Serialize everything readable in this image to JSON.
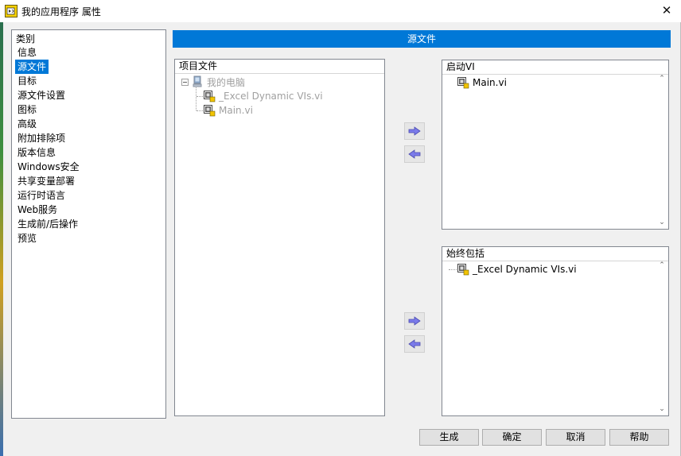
{
  "window": {
    "title": "我的应用程序 属性",
    "close_glyph": "✕"
  },
  "sidebar": {
    "header": "类别",
    "items": [
      {
        "label": "信息",
        "selected": false
      },
      {
        "label": "源文件",
        "selected": true
      },
      {
        "label": "目标",
        "selected": false
      },
      {
        "label": "源文件设置",
        "selected": false
      },
      {
        "label": "图标",
        "selected": false
      },
      {
        "label": "高级",
        "selected": false
      },
      {
        "label": "附加排除项",
        "selected": false
      },
      {
        "label": "版本信息",
        "selected": false
      },
      {
        "label": "Windows安全",
        "selected": false
      },
      {
        "label": "共享变量部署",
        "selected": false
      },
      {
        "label": "运行时语言",
        "selected": false
      },
      {
        "label": "Web服务",
        "selected": false
      },
      {
        "label": "生成前/后操作",
        "selected": false
      },
      {
        "label": "预览",
        "selected": false
      }
    ]
  },
  "main": {
    "section_title": "源文件",
    "project_files": {
      "header": "项目文件",
      "root": "我的电脑",
      "children": [
        "_Excel Dynamic VIs.vi",
        "Main.vi"
      ]
    },
    "startup_vis": {
      "header": "启动VI",
      "items": [
        "Main.vi"
      ]
    },
    "always_included": {
      "header": "始终包括",
      "items": [
        "_Excel Dynamic VIs.vi"
      ]
    },
    "arrow_glyphs": {
      "add": "⇨",
      "remove": "⇦"
    }
  },
  "buttons": {
    "build": "生成",
    "ok": "确定",
    "cancel": "取消",
    "help": "帮助"
  },
  "colors": {
    "accent": "#0078d7",
    "arrow": "#5b5bd6"
  },
  "icons": {
    "app": "labview-app-icon",
    "vi": "vi-file-icon",
    "computer": "computer-icon",
    "add_arrow": "arrow-right-icon",
    "remove_arrow": "arrow-left-icon"
  }
}
